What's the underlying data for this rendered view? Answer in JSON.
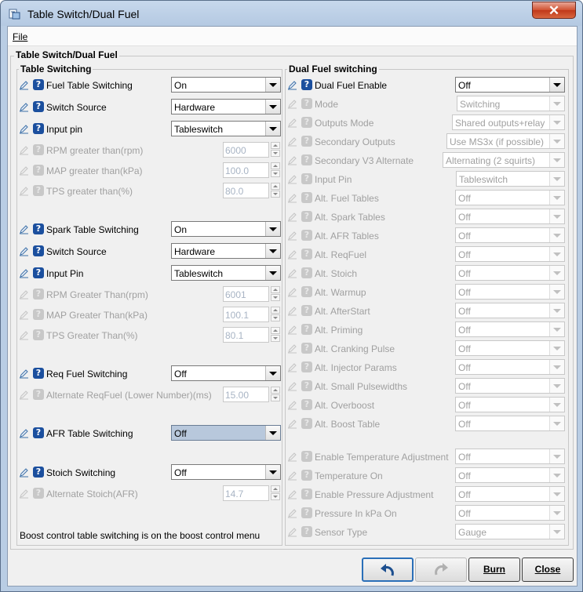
{
  "window": {
    "title": "Table Switch/Dual Fuel",
    "close_glyph": "✕"
  },
  "menu": {
    "file": "File"
  },
  "main_group": {
    "title": "Table Switch/Dual Fuel"
  },
  "left": {
    "title": "Table Switching",
    "rows": [
      {
        "kind": "combo",
        "label": "Fuel Table Switching",
        "value": "On",
        "enabled": true
      },
      {
        "kind": "combo",
        "label": "Switch Source",
        "value": "Hardware",
        "enabled": true
      },
      {
        "kind": "combo",
        "label": "Input pin",
        "value": "Tableswitch",
        "enabled": true
      },
      {
        "kind": "spin",
        "label": "RPM greater than(rpm)",
        "value": "6000",
        "enabled": false
      },
      {
        "kind": "spin",
        "label": "MAP greater than(kPa)",
        "value": "100.0",
        "enabled": false
      },
      {
        "kind": "spin",
        "label": "TPS greater than(%)",
        "value": "80.0",
        "enabled": false
      },
      {
        "kind": "combo",
        "label": "Spark Table Switching",
        "value": "On",
        "enabled": true
      },
      {
        "kind": "combo",
        "label": "Switch Source",
        "value": "Hardware",
        "enabled": true
      },
      {
        "kind": "combo",
        "label": "Input Pin",
        "value": "Tableswitch",
        "enabled": true
      },
      {
        "kind": "spin",
        "label": "RPM Greater Than(rpm)",
        "value": "6001",
        "enabled": false
      },
      {
        "kind": "spin",
        "label": "MAP Greater Than(kPa)",
        "value": "100.1",
        "enabled": false
      },
      {
        "kind": "spin",
        "label": "TPS Greater Than(%)",
        "value": "80.1",
        "enabled": false
      },
      {
        "kind": "combo",
        "label": "Req Fuel Switching",
        "value": "Off",
        "enabled": true
      },
      {
        "kind": "spin",
        "label": "Alternate ReqFuel (Lower Number)(ms)",
        "value": "15.00",
        "enabled": false
      },
      {
        "kind": "combo",
        "label": "AFR Table Switching",
        "value": "Off",
        "enabled": true,
        "selected": true
      },
      {
        "kind": "combo",
        "label": "Stoich Switching",
        "value": "Off",
        "enabled": true
      },
      {
        "kind": "spin",
        "label": "Alternate Stoich(AFR)",
        "value": "14.7",
        "enabled": false
      }
    ],
    "note": "Boost control table switching is on the boost control menu"
  },
  "right": {
    "title": "Dual Fuel switching",
    "rows": [
      {
        "label": "Dual Fuel Enable",
        "value": "Off",
        "enabled": true
      },
      {
        "label": "Mode",
        "value": "Switching",
        "enabled": false
      },
      {
        "label": "Outputs Mode",
        "value": "Shared outputs+relay",
        "enabled": false
      },
      {
        "label": "Secondary Outputs",
        "value": "Use MS3x (if possible)",
        "enabled": false
      },
      {
        "label": "Secondary V3 Alternate",
        "value": "Alternating (2 squirts)",
        "enabled": false
      },
      {
        "label": "Input Pin",
        "value": "Tableswitch",
        "enabled": false
      },
      {
        "label": "Alt. Fuel Tables",
        "value": "Off",
        "enabled": false
      },
      {
        "label": "Alt. Spark Tables",
        "value": "Off",
        "enabled": false
      },
      {
        "label": "Alt. AFR Tables",
        "value": "Off",
        "enabled": false
      },
      {
        "label": "Alt. ReqFuel",
        "value": "Off",
        "enabled": false
      },
      {
        "label": "Alt. Stoich",
        "value": "Off",
        "enabled": false
      },
      {
        "label": "Alt. Warmup",
        "value": "Off",
        "enabled": false
      },
      {
        "label": "Alt. AfterStart",
        "value": "Off",
        "enabled": false
      },
      {
        "label": "Alt. Priming",
        "value": "Off",
        "enabled": false
      },
      {
        "label": "Alt. Cranking Pulse",
        "value": "Off",
        "enabled": false
      },
      {
        "label": "Alt. Injector Params",
        "value": "Off",
        "enabled": false
      },
      {
        "label": "Alt. Small Pulsewidths",
        "value": "Off",
        "enabled": false
      },
      {
        "label": "Alt. Overboost",
        "value": "Off",
        "enabled": false
      },
      {
        "label": "Alt. Boost Table",
        "value": "Off",
        "enabled": false
      },
      {
        "label": "Enable Temperature Adjustment",
        "value": "Off",
        "enabled": false
      },
      {
        "label": "Temperature On",
        "value": "Off",
        "enabled": false
      },
      {
        "label": "Enable Pressure Adjustment",
        "value": "Off",
        "enabled": false
      },
      {
        "label": "Pressure In kPa On",
        "value": "Off",
        "enabled": false
      },
      {
        "label": "Sensor Type",
        "value": "Gauge",
        "enabled": false
      }
    ]
  },
  "buttons": {
    "undo_icon": "undo-arrow-icon",
    "redo_icon": "redo-arrow-icon",
    "burn": "Burn",
    "close": "Close"
  },
  "icons": {
    "help": "?",
    "edit": "pencil-icon"
  },
  "colors": {
    "help_enabled": "#1b4f9e",
    "title_bar": "#b4c9e2",
    "close_button": "#c0381a"
  }
}
